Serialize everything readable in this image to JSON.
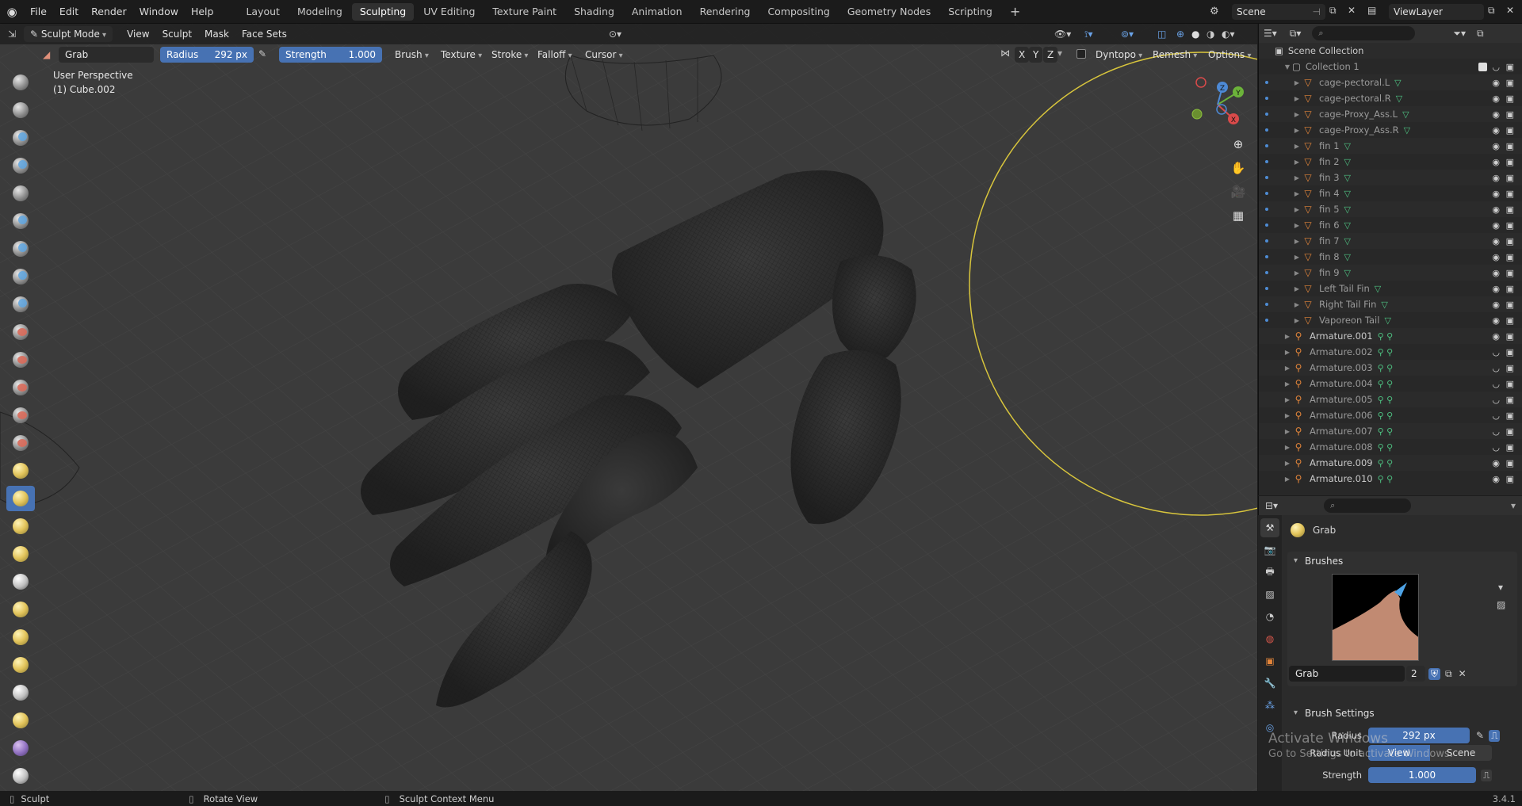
{
  "topbar": {
    "menus": [
      "File",
      "Edit",
      "Render",
      "Window",
      "Help"
    ],
    "workspaces": [
      "Layout",
      "Modeling",
      "Sculpting",
      "UV Editing",
      "Texture Paint",
      "Shading",
      "Animation",
      "Rendering",
      "Compositing",
      "Geometry Nodes",
      "Scripting"
    ],
    "active_workspace": "Sculpting",
    "add_tab": "+",
    "scene": "Scene",
    "view_layer": "ViewLayer"
  },
  "header3d": {
    "mode": "Sculpt Mode",
    "menus": [
      "View",
      "Sculpt",
      "Mask",
      "Face Sets"
    ],
    "brush_name": "Grab",
    "radius_label": "Radius",
    "radius_value": "292 px",
    "strength_label": "Strength",
    "strength_value": "1.000",
    "dropdowns": [
      "Brush",
      "Texture",
      "Stroke",
      "Falloff",
      "Cursor"
    ],
    "axes": [
      "X",
      "Y",
      "Z"
    ],
    "dyntopo": "Dyntopo",
    "remesh": "Remesh",
    "options": "Options"
  },
  "viewport": {
    "perspective": "User Perspective",
    "object": "(1) Cube.002",
    "gizmo_axes": [
      "X",
      "Y",
      "Z"
    ]
  },
  "outliner": {
    "root": "Scene Collection",
    "collection": "Collection 1",
    "items": [
      {
        "name": "cage-pectoral.L",
        "type": "mesh",
        "dim": true
      },
      {
        "name": "cage-pectoral.R",
        "type": "mesh",
        "dim": true
      },
      {
        "name": "cage-Proxy_Ass.L",
        "type": "mesh",
        "dim": true
      },
      {
        "name": "cage-Proxy_Ass.R",
        "type": "mesh",
        "dim": true
      },
      {
        "name": "fin 1",
        "type": "mesh",
        "dim": true
      },
      {
        "name": "fin 2",
        "type": "mesh",
        "dim": true
      },
      {
        "name": "fin 3",
        "type": "mesh",
        "dim": true
      },
      {
        "name": "fin 4",
        "type": "mesh",
        "dim": true
      },
      {
        "name": "fin 5",
        "type": "mesh",
        "dim": true
      },
      {
        "name": "fin 6",
        "type": "mesh",
        "dim": true
      },
      {
        "name": "fin 7",
        "type": "mesh",
        "dim": true
      },
      {
        "name": "fin 8",
        "type": "mesh",
        "dim": true
      },
      {
        "name": "fin 9",
        "type": "mesh",
        "dim": true
      },
      {
        "name": "Left Tail Fin",
        "type": "mesh",
        "dim": true
      },
      {
        "name": "Right Tail Fin",
        "type": "mesh",
        "dim": true
      },
      {
        "name": "Vaporeon Tail",
        "type": "mesh",
        "dim": true
      },
      {
        "name": "Armature.001",
        "type": "armature",
        "dim": false
      },
      {
        "name": "Armature.002",
        "type": "armature",
        "dim": true
      },
      {
        "name": "Armature.003",
        "type": "armature",
        "dim": true
      },
      {
        "name": "Armature.004",
        "type": "armature",
        "dim": true
      },
      {
        "name": "Armature.005",
        "type": "armature",
        "dim": true
      },
      {
        "name": "Armature.006",
        "type": "armature",
        "dim": true
      },
      {
        "name": "Armature.007",
        "type": "armature",
        "dim": true
      },
      {
        "name": "Armature.008",
        "type": "armature",
        "dim": true
      },
      {
        "name": "Armature.009",
        "type": "armature",
        "dim": false
      },
      {
        "name": "Armature.010",
        "type": "armature",
        "dim": false
      }
    ]
  },
  "properties": {
    "tool_name": "Grab",
    "brushes_panel": "Brushes",
    "brush_field": "Grab",
    "brush_users": "2",
    "brush_settings_panel": "Brush Settings",
    "radius_label": "Radius",
    "radius_value": "292 px",
    "radius_unit_label": "Radius Unit",
    "unit_view": "View",
    "unit_scene": "Scene",
    "strength_label": "Strength",
    "strength_value": "1.000"
  },
  "watermark": {
    "line1": "Activate Windows",
    "line2": "Go to Settings to activate Windows."
  },
  "statusbar": {
    "left": "Sculpt",
    "mid": "Rotate View",
    "right": "Sculpt Context Menu",
    "version": "3.4.1"
  }
}
